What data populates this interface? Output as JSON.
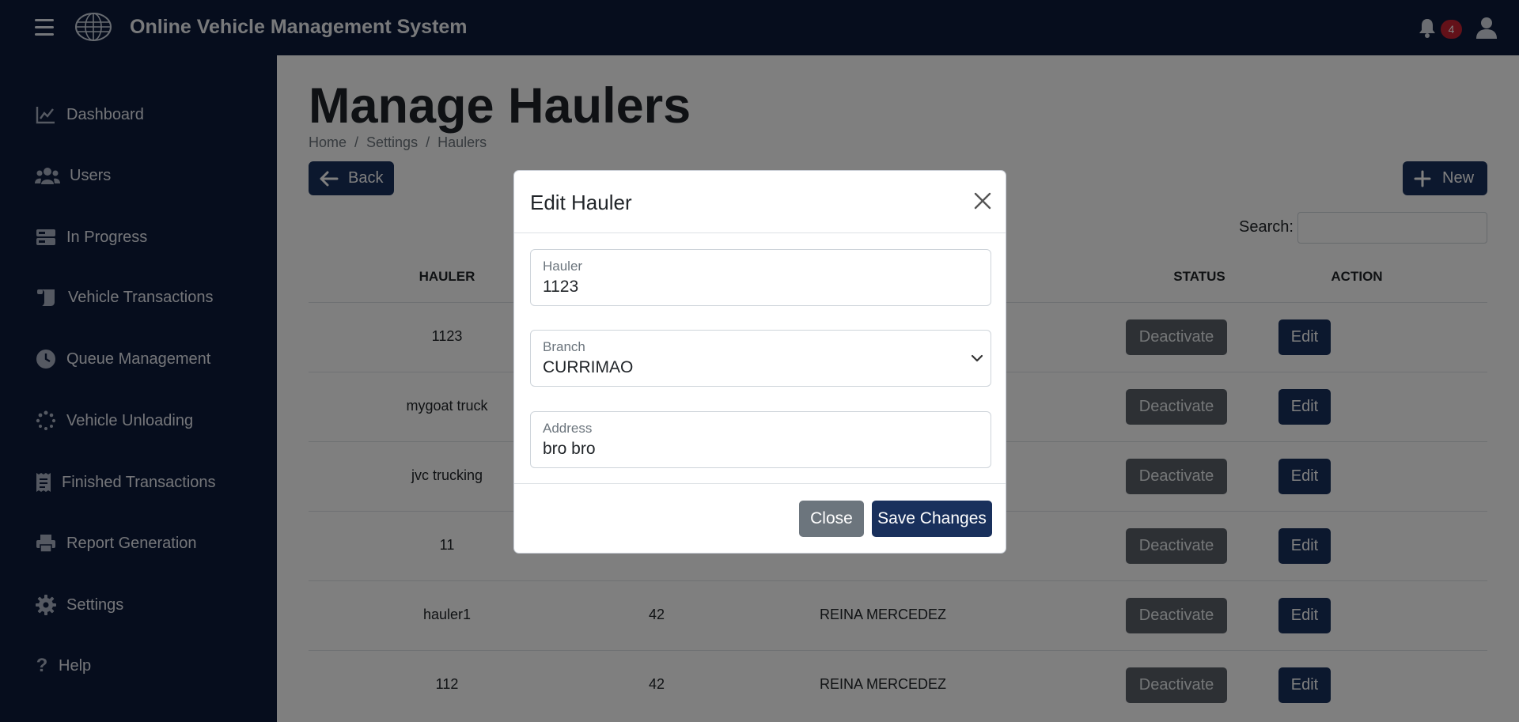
{
  "app": {
    "title": "Online Vehicle Management System",
    "notification_count": "4"
  },
  "sidebar": {
    "items": [
      {
        "label": "Dashboard",
        "icon": "chart-line-icon"
      },
      {
        "label": "Users",
        "icon": "users-icon"
      },
      {
        "label": "In Progress",
        "icon": "server-icon"
      },
      {
        "label": "Vehicle Transactions",
        "icon": "scroll-icon"
      },
      {
        "label": "Queue Management",
        "icon": "clock-icon"
      },
      {
        "label": "Vehicle Unloading",
        "icon": "spinner-icon"
      },
      {
        "label": "Finished Transactions",
        "icon": "receipt-icon"
      },
      {
        "label": "Report Generation",
        "icon": "printer-icon"
      },
      {
        "label": "Settings",
        "icon": "gear-icon"
      },
      {
        "label": "Help",
        "icon": "question-icon"
      }
    ]
  },
  "page": {
    "title": "Manage Haulers",
    "breadcrumb": [
      "Home",
      "Settings",
      "Haulers"
    ],
    "back_label": "Back",
    "new_label": "New",
    "search_label": "Search:"
  },
  "table": {
    "headers": {
      "hauler": "HAULER",
      "status": "STATUS",
      "action": "ACTION"
    },
    "rows": [
      {
        "hauler": "1123",
        "col2": "",
        "col3": "",
        "status_btn": "Deactivate",
        "action_btn": "Edit"
      },
      {
        "hauler": "mygoat truck",
        "col2": "",
        "col3": "",
        "status_btn": "Deactivate",
        "action_btn": "Edit"
      },
      {
        "hauler": "jvc trucking",
        "col2": "",
        "col3": "",
        "status_btn": "Deactivate",
        "action_btn": "Edit"
      },
      {
        "hauler": "11",
        "col2": "",
        "col3": "",
        "status_btn": "Deactivate",
        "action_btn": "Edit"
      },
      {
        "hauler": "hauler1",
        "col2": "42",
        "col3": "REINA MERCEDEZ",
        "status_btn": "Deactivate",
        "action_btn": "Edit"
      },
      {
        "hauler": "112",
        "col2": "42",
        "col3": "REINA MERCEDEZ",
        "status_btn": "Deactivate",
        "action_btn": "Edit"
      }
    ]
  },
  "modal": {
    "title": "Edit Hauler",
    "fields": {
      "hauler": {
        "label": "Hauler",
        "value": "1123"
      },
      "branch": {
        "label": "Branch",
        "value": "CURRIMAO"
      },
      "address": {
        "label": "Address",
        "value": "bro bro"
      }
    },
    "close_label": "Close",
    "save_label": "Save Changes"
  }
}
